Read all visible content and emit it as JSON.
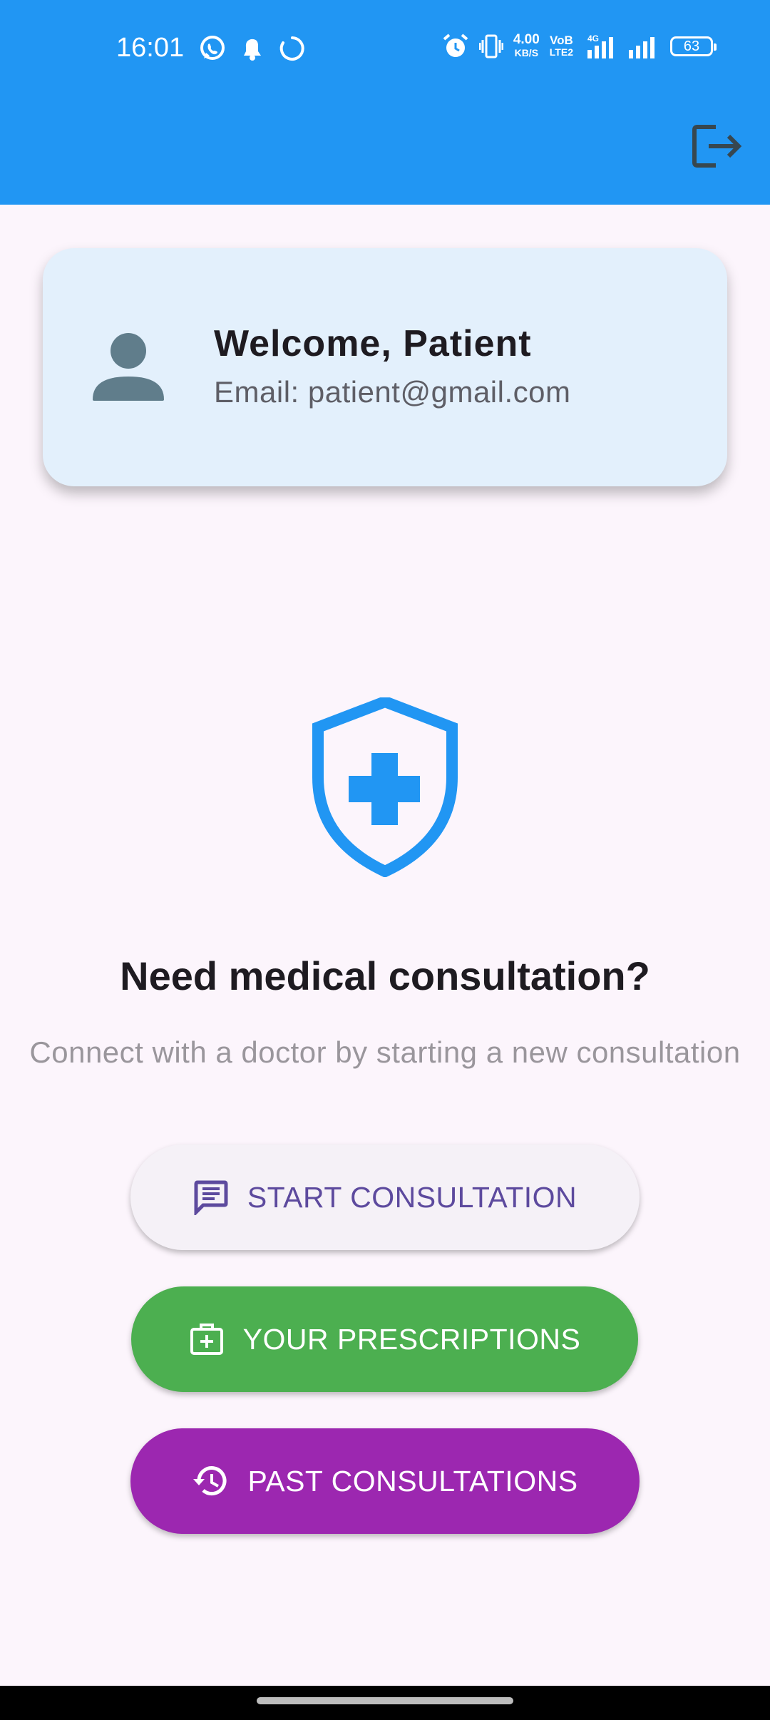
{
  "status_bar": {
    "time": "16:01",
    "speed_value": "4.00",
    "speed_unit": "KB/S",
    "volte_top": "VoB",
    "volte_bottom": "LTE2",
    "network": "4G",
    "battery": "63"
  },
  "appbar": {
    "bg_color": "#2196F3",
    "logout_icon": "logout-icon"
  },
  "profile": {
    "welcome": "Welcome, Patient",
    "email": "Email: patient@gmail.com",
    "avatar_icon": "person-icon"
  },
  "hero": {
    "icon": "medical-shield-icon",
    "title": "Need medical consultation?",
    "subtitle": "Connect with a doctor by starting a new consultation"
  },
  "actions": {
    "start_label": "START CONSULTATION",
    "start_icon": "chat-icon",
    "prescriptions_label": "YOUR PRESCRIPTIONS",
    "prescriptions_icon": "medical-bag-icon",
    "past_label": "PAST CONSULTATIONS",
    "past_icon": "history-icon"
  },
  "colors": {
    "primary": "#2196F3",
    "green": "#4CAF50",
    "purple": "#9C27B0",
    "start_text": "#5D4A9E"
  }
}
